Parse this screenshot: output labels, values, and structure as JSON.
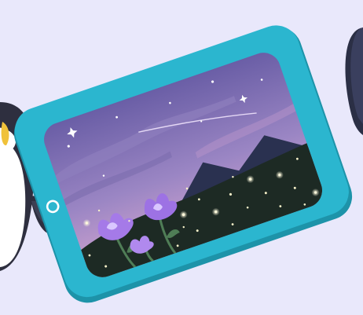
{
  "scene": {
    "background_color": "#e9e8fb",
    "tablet": {
      "frame_color": "#2bb6cf",
      "frame_edge_color": "#1d93a9",
      "home_button_icon": "circle-home-button"
    },
    "screen_art": {
      "sky_top_color": "#6a5ea6",
      "sky_mid_color": "#9b86c4",
      "sky_horizon_color": "#d7a7d0",
      "mountain_color": "#2a3150",
      "meadow_color": "#1d2a24",
      "flower_color": "#a57ae8",
      "firefly_color": "#f6f1c9",
      "stem_color": "#4f7d56"
    },
    "characters": {
      "left": "penguin-character",
      "right": "partial-round-character"
    }
  }
}
